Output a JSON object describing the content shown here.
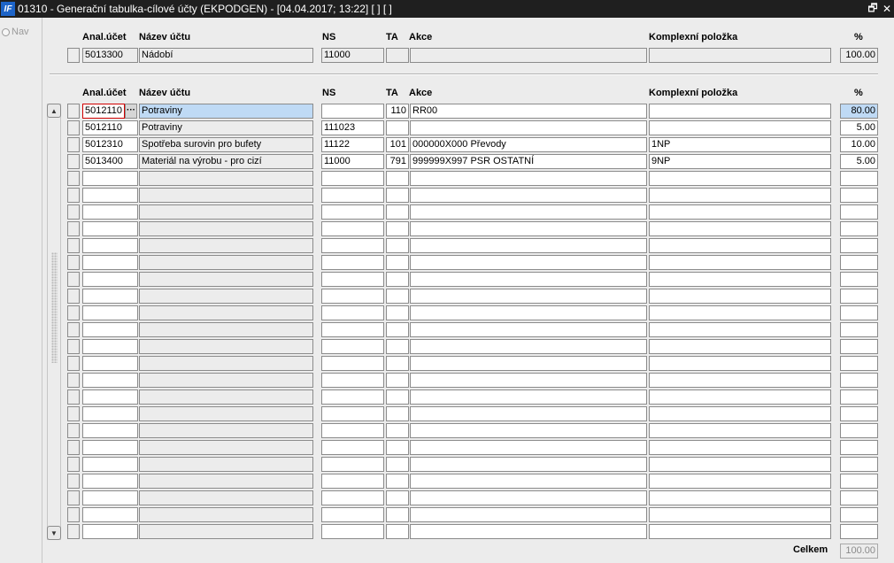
{
  "window": {
    "title": "01310 - Generační tabulka-cílové účty (EKPODGEN) - [04.04.2017; 13:22] [ ] [ ]",
    "restore_glyph": "🗗",
    "close_glyph": "✕",
    "app_icon_glyph": "IF"
  },
  "nav": {
    "label": "Nav"
  },
  "columns": {
    "anal": "Anal.účet",
    "nazev": "Název účtu",
    "ns": "NS",
    "ta": "TA",
    "akce": "Akce",
    "komplex": "Komplexní položka",
    "pct": "%"
  },
  "source": {
    "anal": "5013300",
    "nazev": "Nádobí",
    "ns": "11000",
    "ta": "",
    "akce": "",
    "komplex": "",
    "pct": "100.00"
  },
  "rows": [
    {
      "anal": "5012110",
      "nazev": "Potraviny",
      "ns": "",
      "ta": "110",
      "akce": "RR00",
      "komplex": "",
      "pct": "80.00"
    },
    {
      "anal": "5012110",
      "nazev": "Potraviny",
      "ns": "111023",
      "ta": "",
      "akce": "",
      "komplex": "",
      "pct": "5.00"
    },
    {
      "anal": "5012310",
      "nazev": "Spotřeba surovin pro bufety",
      "ns": "11122",
      "ta": "101",
      "akce": "000000X000 Převody",
      "komplex": "1NP",
      "pct": "10.00"
    },
    {
      "anal": "5013400",
      "nazev": "Materiál na výrobu - pro cizí",
      "ns": "11000",
      "ta": "791",
      "akce": "999999X997 PSR OSTATNÍ",
      "komplex": "9NP",
      "pct": "5.00"
    },
    {
      "anal": "",
      "nazev": "",
      "ns": "",
      "ta": "",
      "akce": "",
      "komplex": "",
      "pct": ""
    },
    {
      "anal": "",
      "nazev": "",
      "ns": "",
      "ta": "",
      "akce": "",
      "komplex": "",
      "pct": ""
    },
    {
      "anal": "",
      "nazev": "",
      "ns": "",
      "ta": "",
      "akce": "",
      "komplex": "",
      "pct": ""
    },
    {
      "anal": "",
      "nazev": "",
      "ns": "",
      "ta": "",
      "akce": "",
      "komplex": "",
      "pct": ""
    },
    {
      "anal": "",
      "nazev": "",
      "ns": "",
      "ta": "",
      "akce": "",
      "komplex": "",
      "pct": ""
    },
    {
      "anal": "",
      "nazev": "",
      "ns": "",
      "ta": "",
      "akce": "",
      "komplex": "",
      "pct": ""
    },
    {
      "anal": "",
      "nazev": "",
      "ns": "",
      "ta": "",
      "akce": "",
      "komplex": "",
      "pct": ""
    },
    {
      "anal": "",
      "nazev": "",
      "ns": "",
      "ta": "",
      "akce": "",
      "komplex": "",
      "pct": ""
    },
    {
      "anal": "",
      "nazev": "",
      "ns": "",
      "ta": "",
      "akce": "",
      "komplex": "",
      "pct": ""
    },
    {
      "anal": "",
      "nazev": "",
      "ns": "",
      "ta": "",
      "akce": "",
      "komplex": "",
      "pct": ""
    },
    {
      "anal": "",
      "nazev": "",
      "ns": "",
      "ta": "",
      "akce": "",
      "komplex": "",
      "pct": ""
    },
    {
      "anal": "",
      "nazev": "",
      "ns": "",
      "ta": "",
      "akce": "",
      "komplex": "",
      "pct": ""
    },
    {
      "anal": "",
      "nazev": "",
      "ns": "",
      "ta": "",
      "akce": "",
      "komplex": "",
      "pct": ""
    },
    {
      "anal": "",
      "nazev": "",
      "ns": "",
      "ta": "",
      "akce": "",
      "komplex": "",
      "pct": ""
    },
    {
      "anal": "",
      "nazev": "",
      "ns": "",
      "ta": "",
      "akce": "",
      "komplex": "",
      "pct": ""
    },
    {
      "anal": "",
      "nazev": "",
      "ns": "",
      "ta": "",
      "akce": "",
      "komplex": "",
      "pct": ""
    },
    {
      "anal": "",
      "nazev": "",
      "ns": "",
      "ta": "",
      "akce": "",
      "komplex": "",
      "pct": ""
    },
    {
      "anal": "",
      "nazev": "",
      "ns": "",
      "ta": "",
      "akce": "",
      "komplex": "",
      "pct": ""
    },
    {
      "anal": "",
      "nazev": "",
      "ns": "",
      "ta": "",
      "akce": "",
      "komplex": "",
      "pct": ""
    },
    {
      "anal": "",
      "nazev": "",
      "ns": "",
      "ta": "",
      "akce": "",
      "komplex": "",
      "pct": ""
    },
    {
      "anal": "",
      "nazev": "",
      "ns": "",
      "ta": "",
      "akce": "",
      "komplex": "",
      "pct": ""
    },
    {
      "anal": "",
      "nazev": "",
      "ns": "",
      "ta": "",
      "akce": "",
      "komplex": "",
      "pct": ""
    }
  ],
  "footer": {
    "total_label": "Celkem",
    "total_value": "100.00"
  },
  "icons": {
    "scroll_up": "triangle-up-icon",
    "scroll_down": "triangle-down-icon",
    "lov": "ellipsis-icon"
  }
}
